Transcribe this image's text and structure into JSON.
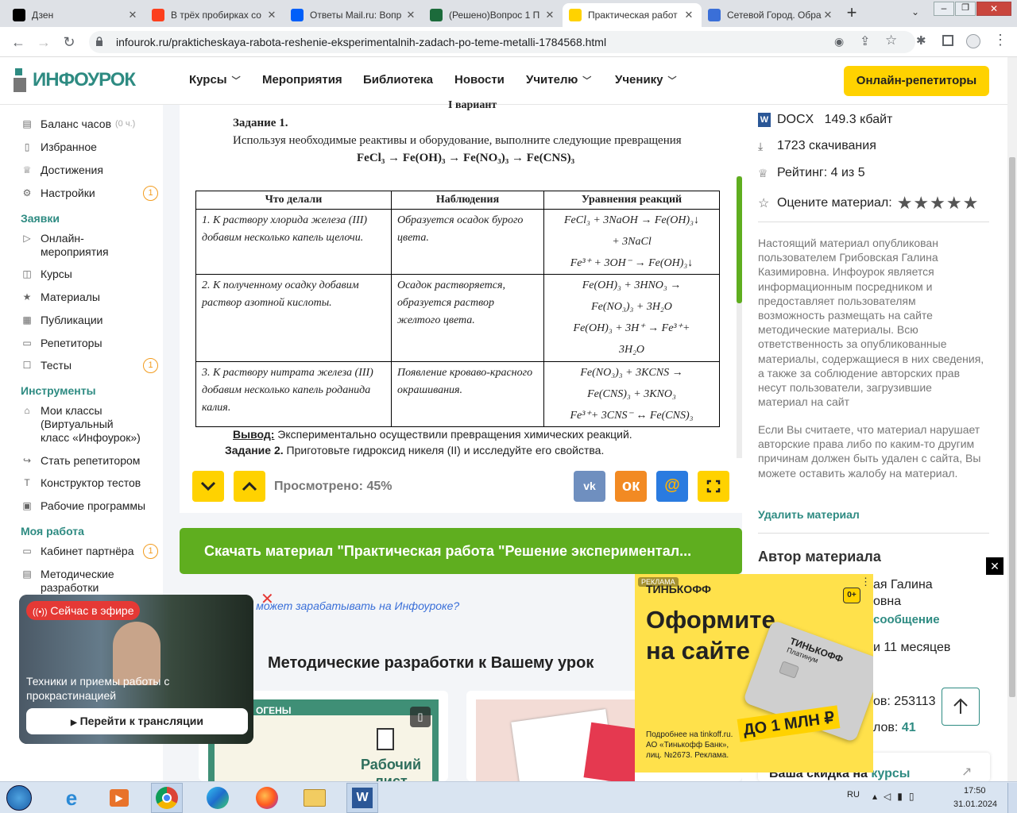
{
  "tabs": [
    {
      "title": "Дзен",
      "icon": "dzen-icon",
      "color": "#000000"
    },
    {
      "title": "В трёх пробирках со",
      "icon": "yandex-icon",
      "color": "#fc3f1d"
    },
    {
      "title": "Ответы Mail.ru: Вопр",
      "icon": "mailru-answers-icon",
      "color": "#005ff9"
    },
    {
      "title": "(Решено)Вопрос 1 П",
      "icon": "reshak-icon",
      "color": "#1c6b3b"
    },
    {
      "title": "Практическая работ",
      "icon": "infourok-icon",
      "color": "#ffd200"
    },
    {
      "title": "Сетевой Город. Обра",
      "icon": "setevoy-gorod-icon",
      "color": "#3a6fd8"
    }
  ],
  "address": {
    "url": "infourok.ru/prakticheskaya-rabota-reshenie-eksperimentalnih-zadach-po-teme-metalli-1784568.html"
  },
  "header": {
    "logo": "ИНФОУРОК",
    "menu": [
      "Курсы",
      "Мероприятия",
      "Библиотека",
      "Новости",
      "Учителю",
      "Ученику"
    ],
    "cta": "Онлайн-репетиторы"
  },
  "sidebar": {
    "items_top": [
      {
        "label": "Баланс часов",
        "extra": "(0 ч.)"
      },
      {
        "label": "Избранное"
      },
      {
        "label": "Достижения"
      },
      {
        "label": "Настройки",
        "badge": "1"
      }
    ],
    "section_requests": "Заявки",
    "items_requests": [
      {
        "label": "Онлайн-\nмероприятия"
      },
      {
        "label": "Курсы"
      },
      {
        "label": "Материалы"
      },
      {
        "label": "Публикации"
      },
      {
        "label": "Репетиторы"
      },
      {
        "label": "Тесты",
        "badge": "1"
      }
    ],
    "section_tools": "Инструменты",
    "items_tools": [
      {
        "label": "Мои классы\n(Виртуальный\nкласс «Инфоурок»)"
      },
      {
        "label": "Стать репетитором"
      },
      {
        "label": "Конструктор тестов"
      },
      {
        "label": "Рабочие программы"
      }
    ],
    "section_work": "Моя работа",
    "items_work": [
      {
        "label": "Кабинет партнёра",
        "badge": "1"
      },
      {
        "label": "Методические\nразработки"
      }
    ]
  },
  "doc": {
    "variant": "I вариант",
    "task1": "Задание 1.",
    "task1_text": "Используя необходимые реактивы и оборудование, выполните следующие превращения",
    "chain": "FeCl₃ → Fe(OH)₃ → Fe(NO₃)₃ → Fe(CNS)₃",
    "table_headers": [
      "Что делали",
      "Наблюдения",
      "Уравнения реакций"
    ],
    "rows": [
      {
        "did": "1. К  раствору хлорида  железа (III) добавим  несколько капель щелочи.",
        "obs": "Образуется осадок бурого цвета.",
        "eq": [
          "FeCl₃ + 3NaOH → Fe(OH)₃↓",
          "+ 3NaCl",
          "Fe³⁺ + 3OH⁻ → Fe(OH)₃↓"
        ]
      },
      {
        "did": "2. К полученному осадку добавим раствор азотной кислоты.",
        "obs": "Осадок растворяется, образуется раствор желтого цвета.",
        "eq": [
          "Fe(OH)₃ + 3HNO₃ →",
          "Fe(NO₃)₃ + 3H₂O",
          "Fe(OH)₃ + 3H⁺ → Fe³⁺+",
          "3H₂O"
        ]
      },
      {
        "did": "3. К  раствору нитрата  железа (III) добавим  несколько капель роданида калия.",
        "obs": "Появление кроваво-красного окрашивания.",
        "eq": [
          "Fe(NO₃)₃ + 3KCNS →",
          "Fe(CNS)₃ + 3KNO₃",
          "Fe³⁺+ 3CNS⁻ ↔ Fe(CNS)₃"
        ]
      }
    ],
    "conclusion_label": "Вывод:",
    "conclusion": " Экспериментально осуществили превращения химических реакций.",
    "task2_label": "Задание 2.",
    "task2": "  Приготовьте гидроксид  никеля (II) и исследуйте его свойства.",
    "viewed": "Просмотрено: 45%"
  },
  "download": "Скачать материал \"Практическая работа \"Решение экспериментал...",
  "earn_link": "ь может зарабатывать на Инфоуроке?",
  "dev_title": "Методические разработки к Вашему урок",
  "card1": {
    "title": "Рабочий лист",
    "tag": "ОГЕНЫ"
  },
  "right": {
    "format": "DOCX",
    "size": "149.3 кбайт",
    "downloads": "1723 скачивания",
    "rating": "Рейтинг: 4 из 5",
    "rate": "Оцените материал:",
    "notice": "Настоящий материал опубликован пользователем Грибовская Галина Казимировна. Инфоурок является информационным посредником и предоставляет пользователям возможность размещать на сайте методические материалы. Всю ответственность за опубликованные материалы, содержащиеся в них сведения, а также за соблюдение авторских прав несут пользователи, загрузившие материал на сайт",
    "complaint": "Если Вы считаете, что материал нарушает авторские права либо по каким-то другим причинам должен быть удален с сайта, Вы можете оставить жалобу на материал.",
    "delete": "Удалить материал",
    "author_title": "Автор материала",
    "author_name_1": "ая Галина",
    "author_name_2": "овна",
    "message": "сообщение",
    "months": "и 11 месяцев",
    "views": "ов: 253113",
    "materials_label": "лов: ",
    "materials": "41",
    "discount": "Ваша скидка на ",
    "discount_link": "курсы"
  },
  "live": {
    "badge": "Сейчас в эфире",
    "title": "Техники и приемы работы с прокрастинацией",
    "button": "Перейти к трансляции"
  },
  "ad": {
    "label": "РЕКЛАМА",
    "brand": "ТИНЬКОФФ",
    "age": "0+",
    "headline": "Оформите на сайте",
    "card_brand": "ТИНЬКОФФ",
    "card_sub": "Платинум",
    "promo": "ДО 1 МЛН ₽",
    "legal": "Подробнее на tinkoff.ru. АО «Тинькофф Банк», лиц. №2673. Реклама."
  },
  "tray": {
    "lang": "RU",
    "time": "17:50",
    "date": "31.01.2024"
  },
  "colors": {
    "brand_green": "#2e8b82",
    "cta_yellow": "#ffd200",
    "download_green": "#5fae1f",
    "vk": "#6f8fbf",
    "ok": "#f28a23",
    "mail": "#2a7be0"
  }
}
